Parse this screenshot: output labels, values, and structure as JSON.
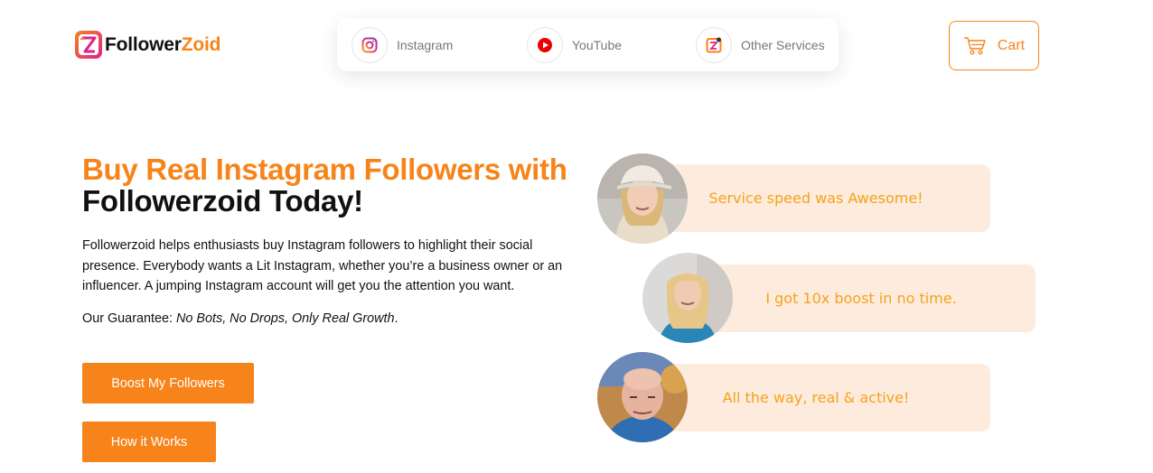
{
  "brand": {
    "name_part1": "Follower",
    "name_part2": "Zoid",
    "accent": "#f7841a"
  },
  "nav": {
    "items": [
      {
        "label": "Instagram",
        "icon": "instagram-icon"
      },
      {
        "label": "YouTube",
        "icon": "youtube-icon"
      },
      {
        "label": "Other Services",
        "icon": "other-services-icon"
      }
    ]
  },
  "cart": {
    "label": "Cart",
    "icon": "cart-icon"
  },
  "hero": {
    "title_line1": "Buy Real Instagram Followers with",
    "title_line2": "Followerzoid Today!",
    "description": "Followerzoid helps enthusiasts buy Instagram followers to highlight their social presence. Everybody wants a Lit Instagram, whether you’re a business owner or an influencer. A jumping Instagram account will get you the attention you want.",
    "guarantee_prefix": "Our Guarantee: ",
    "guarantee_text": "No Bots, No Drops, Only Real Growth",
    "guarantee_suffix": ".",
    "cta_primary": "Boost My Followers",
    "cta_secondary": "How it Works"
  },
  "reviews": [
    {
      "text": "Service speed was Awesome!"
    },
    {
      "text": "I got 10x boost in no time."
    },
    {
      "text": "All the way, real & active!"
    }
  ],
  "colors": {
    "bubble_bg": "#fdecdd",
    "bubble_text": "#f5a21c",
    "button_bg": "#f7841a"
  }
}
